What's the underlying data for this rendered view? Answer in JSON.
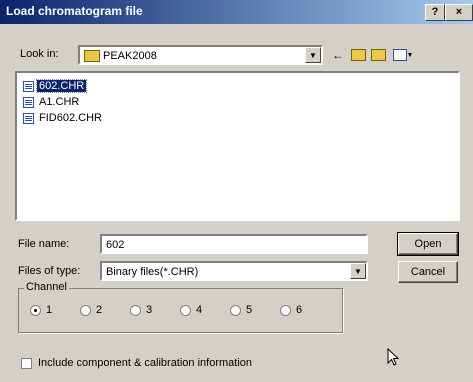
{
  "dialog": {
    "title": "Load chromatogram file",
    "help_symbol": "?",
    "close_symbol": "×"
  },
  "lookin": {
    "label": "Look in:",
    "value": "PEAK2008"
  },
  "files": [
    {
      "name": "602.CHR",
      "selected": true
    },
    {
      "name": "A1.CHR",
      "selected": false
    },
    {
      "name": "FID602.CHR",
      "selected": false
    }
  ],
  "filename": {
    "label": "File name:",
    "value": "602"
  },
  "filetype": {
    "label": "Files of type:",
    "value": "Binary files(*.CHR)"
  },
  "buttons": {
    "open": "Open",
    "cancel": "Cancel"
  },
  "channel": {
    "title": "Channel",
    "options": [
      "1",
      "2",
      "3",
      "4",
      "5",
      "6"
    ],
    "selected": "1"
  },
  "include_checkbox": {
    "label": "Include component & calibration information",
    "checked": false
  },
  "icons": [
    "folder-icon",
    "back-arrow-icon",
    "up-folder-icon",
    "new-folder-icon",
    "view-menu-icon",
    "file-icon",
    "cursor-icon"
  ]
}
